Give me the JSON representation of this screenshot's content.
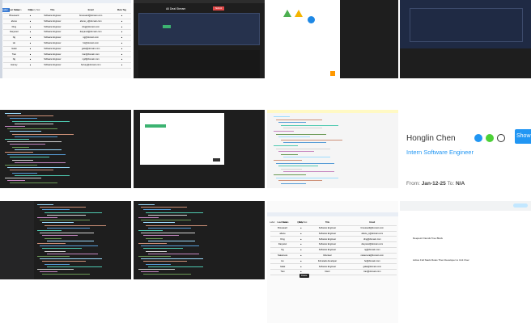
{
  "tile1": {
    "tabs": [
      "Label",
      "Learn",
      "Query Test"
    ],
    "headers": [
      "Last Name",
      "Role",
      "Title",
      "Email",
      "Meta Tag"
    ],
    "rows": [
      [
        "Broussard",
        "Software Engineer",
        "broussard@domain.com"
      ],
      [
        "abene",
        "Software Engineer",
        "abene_s@domain.com"
      ],
      [
        "Ding",
        "Software Engineer",
        "ding@domain.com"
      ],
      [
        "Daryanel",
        "Software Engineer",
        "daryanel@domain.com"
      ],
      [
        "Ng",
        "Software Engineer",
        "ng@domain.com"
      ],
      [
        "Ho",
        "Software Engineer",
        "ho@domain.com"
      ],
      [
        "Galat",
        "Software Engineer",
        "galat@domain.com"
      ],
      [
        "Tran",
        "Software Engineer",
        "tran@domain.com"
      ],
      [
        "Ng",
        "Software Engineer",
        "ng2@domain.com"
      ],
      [
        "Harvey",
        "Software Engineer",
        "harvey@domain.com"
      ]
    ]
  },
  "tile2": {
    "title": "All Deal Stream",
    "button": "Submit"
  },
  "tile8": {
    "name": "Honglin Chen",
    "role": "Intern Software Engineer",
    "from_label": "From:",
    "from_value": "Jan-12-25",
    "to_label": "To:",
    "to_value": "N/A",
    "show_label": "Show",
    "icons": {
      "info": "info-icon",
      "status": "status-dot-icon",
      "timer": "clock-icon"
    },
    "colors": {
      "accent": "#2196f3",
      "status": "#4cd137"
    }
  },
  "tile11": {
    "tabs": [
      "Label",
      "Learn",
      "Query Test"
    ],
    "headers": [
      "Last Name",
      "Role",
      "Title",
      "Email"
    ],
    "rows": [
      [
        "Broussard",
        "Software Engineer",
        "broussard@domain.com"
      ],
      [
        "abene",
        "Software Engineer",
        "abene_s@domain.com"
      ],
      [
        "Ding",
        "Software Engineer",
        "ding@domain.com"
      ],
      [
        "Daryanel",
        "Software Engineer",
        "daryanel@domain.com"
      ],
      [
        "Ng",
        "Software Engineer",
        "ng@domain.com"
      ],
      [
        "Nakamura",
        "Volunteer",
        "nakamura@domain.com"
      ],
      [
        "Ho",
        "Full-stack developer",
        "ho@domain.com"
      ],
      [
        "Galat",
        "Software Engineer",
        "galat@domain.com"
      ],
      [
        "Tran",
        "Intern",
        "tran@domain.com"
      ]
    ],
    "tooltip": "Delete"
  },
  "tile12": {
    "heading1": "Deepest Friends Tree Block",
    "heading2": "Active Full Stack Roles Then Developer to Unit Over"
  }
}
